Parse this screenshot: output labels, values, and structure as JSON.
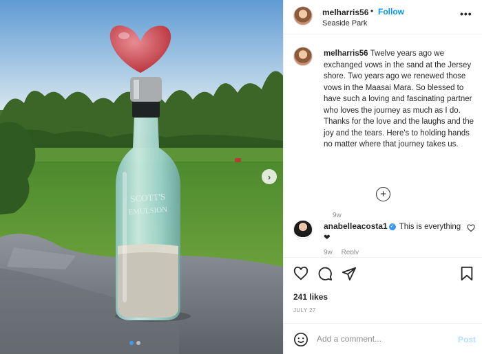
{
  "post": {
    "username": "melharris56",
    "separator": "•",
    "follow_label": "Follow",
    "location": "Seaside Park",
    "more_icon": "more-horizontal-icon",
    "caption": "Twelve years ago we exchanged vows in the sand at the Jersey shore. Two years ago we renewed those vows in the Maasai Mara. So blessed to have such a loving and fascinating partner who loves the journey as much as I do. Thanks for the love and the laughs and the joy and the tears. Here's to holding hands no matter where that journey takes us.",
    "caption_time": "9w",
    "bottle_text_line1": "SCOTT'S",
    "bottle_text_line2": "EMULSION"
  },
  "comments": [
    {
      "username": "anabelleacosta1",
      "text": "This is everything",
      "emoji": "❤",
      "time": "9w",
      "reply_label": "Reply"
    }
  ],
  "actions": {
    "likes": "241 likes",
    "date": "JULY 27"
  },
  "add_comment": {
    "placeholder": "Add a comment...",
    "post_label": "Post"
  },
  "carousel": {
    "current_index": 1,
    "total": 2
  },
  "colors": {
    "accent": "#0095f6",
    "post_disabled": "#b2dffc",
    "verified": "#3897f0",
    "muted": "#8e8e8e"
  }
}
